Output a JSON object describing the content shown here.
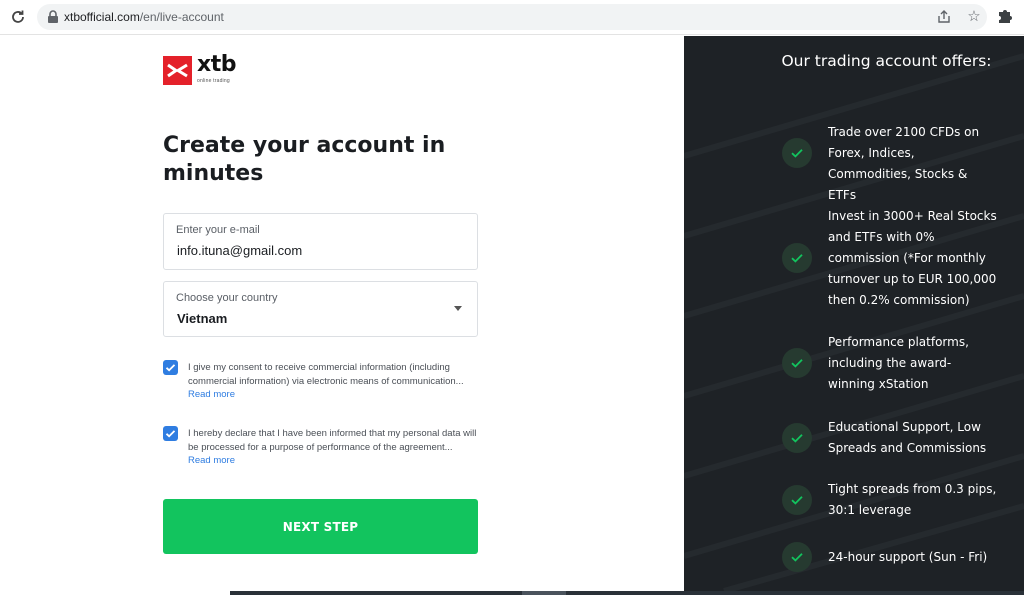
{
  "browser": {
    "url_host": "xtbofficial.com",
    "url_path": "/en/live-account"
  },
  "logo": {
    "word": "xtb",
    "tagline": "online trading"
  },
  "form": {
    "title": "Create your account in minutes",
    "email": {
      "label": "Enter your e-mail",
      "value": "info.ituna@gmail.com"
    },
    "country": {
      "label": "Choose your country",
      "value": "Vietnam"
    },
    "consents": [
      {
        "text": "I give my consent to receive commercial information (including commercial information) via electronic means of communication...",
        "read_more": "Read more",
        "checked": true
      },
      {
        "text": "I hereby declare that I have been informed that my personal data will be processed for a purpose of performance of the agreement...",
        "read_more": "Read more",
        "checked": true
      }
    ],
    "next_button": "NEXT STEP"
  },
  "offers": {
    "title": "Our trading account offers:",
    "items": [
      "Trade over 2100 CFDs on Forex, Indices, Commodities, Stocks & ETFs",
      "Invest in 3000+ Real Stocks and ETFs with 0% commission (*For monthly turnover up to EUR 100,000 then 0.2% commission)",
      "Performance platforms, including the award-winning xStation",
      "Educational Support, Low Spreads and Commissions",
      "Tight spreads from 0.3 pips, 30:1 leverage",
      "24-hour support (Sun - Fri)"
    ]
  },
  "colors": {
    "brand_red": "#e4212a",
    "accent_green": "#12c45e",
    "checkbox_blue": "#2f7de1",
    "panel_dark": "#1e2226"
  }
}
